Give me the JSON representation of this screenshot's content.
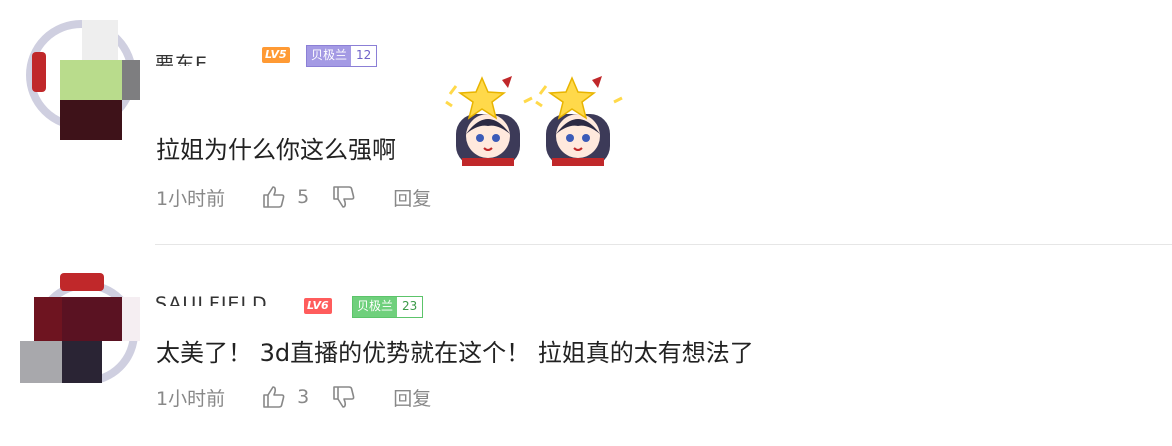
{
  "comments": [
    {
      "username": "要东E",
      "level_badge": "LV5",
      "level_color": "#ff9a34",
      "medal": {
        "name": "贝极兰",
        "level": "12",
        "color": "#8b7fd6"
      },
      "text": "拉姐为什么你这么强啊",
      "time": "1小时前",
      "likes": "5",
      "reply_label": "回复"
    },
    {
      "username": "SAULFIELD",
      "level_badge": "LV6",
      "level_color": "#ff5c5c",
      "medal": {
        "name": "贝极兰",
        "level": "23",
        "color": "#5cc46a"
      },
      "text": "太美了！ 3d直播的优势就在这个！ 拉姐真的太有想法了",
      "time": "1小时前",
      "likes": "3",
      "reply_label": "回复"
    }
  ],
  "icons": {
    "like": "thumbs-up-icon",
    "dislike": "thumbs-down-icon",
    "emote": "star-girl-emote"
  }
}
